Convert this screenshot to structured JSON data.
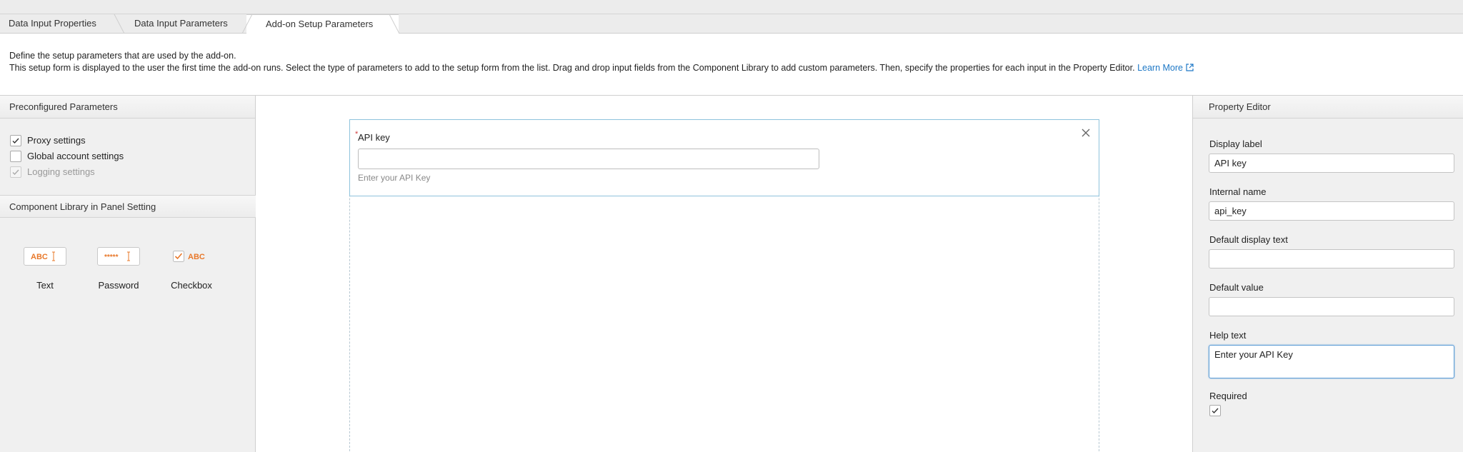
{
  "tabs": [
    {
      "label": "Data Input Properties"
    },
    {
      "label": "Data Input Parameters"
    },
    {
      "label": "Add-on Setup Parameters",
      "active": true
    }
  ],
  "description": {
    "line1": "Define the setup parameters that are used by the add-on.",
    "line2": "This setup form is displayed to the user the first time the add-on runs. Select the type of parameters to add to the setup form from the list. Drag and drop input fields from the Component Library to add custom parameters. Then, specify the properties for each input in the Property Editor.",
    "learn_more": "Learn More"
  },
  "preconfigured": {
    "title": "Preconfigured Parameters",
    "items": [
      {
        "label": "Proxy settings",
        "checked": true,
        "disabled": false
      },
      {
        "label": "Global account settings",
        "checked": false,
        "disabled": false
      },
      {
        "label": "Logging settings",
        "checked": true,
        "disabled": true
      }
    ]
  },
  "component_library": {
    "title": "Component Library in Panel Setting",
    "items": [
      {
        "label": "Text",
        "icon_text": "ABC",
        "icon": "text-field-icon"
      },
      {
        "label": "Password",
        "icon_text": "*****",
        "icon": "password-field-icon"
      },
      {
        "label": "Checkbox",
        "icon_text": "ABC",
        "icon": "checkbox-field-icon"
      }
    ]
  },
  "canvas": {
    "field": {
      "required_marker": "*",
      "label": "API key",
      "help": "Enter your API Key"
    }
  },
  "property_editor": {
    "title": "Property Editor",
    "display_label": {
      "label": "Display label",
      "value": "API key"
    },
    "internal_name": {
      "label": "Internal name",
      "value": "api_key"
    },
    "default_display_text": {
      "label": "Default display text",
      "value": ""
    },
    "default_value": {
      "label": "Default value",
      "value": ""
    },
    "help_text": {
      "label": "Help text",
      "value": "Enter your API Key"
    },
    "required": {
      "label": "Required",
      "checked": true
    }
  },
  "colors": {
    "accent_orange": "#e8782a",
    "link_blue": "#1e78c6",
    "selected_border": "#8ec3dc"
  }
}
